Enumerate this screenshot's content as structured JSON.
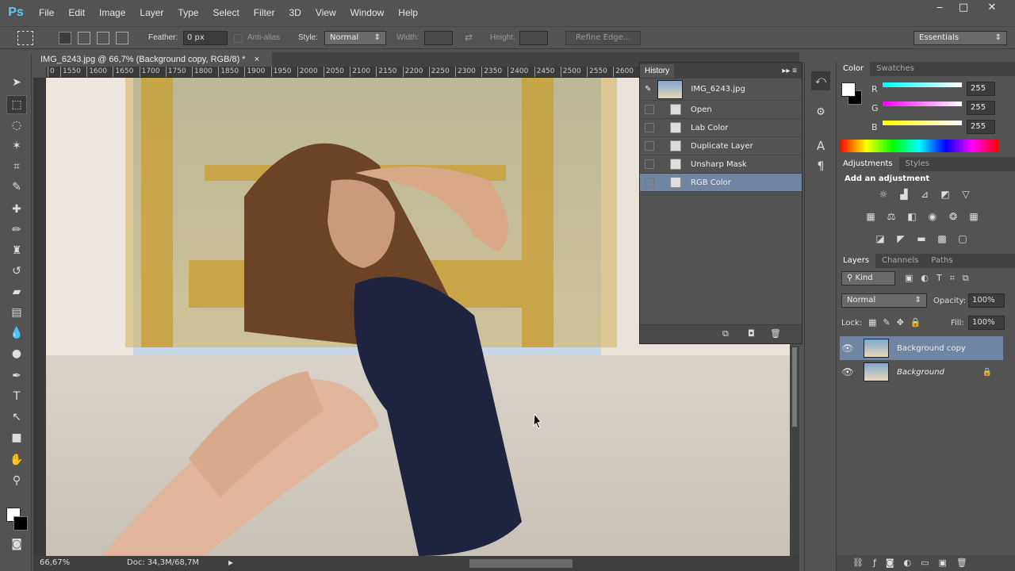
{
  "app": {
    "logo": "Ps"
  },
  "menu": [
    "File",
    "Edit",
    "Image",
    "Layer",
    "Type",
    "Select",
    "Filter",
    "3D",
    "View",
    "Window",
    "Help"
  ],
  "window": {
    "minimize": "‒",
    "maximize": "□",
    "close": "✕"
  },
  "options": {
    "feather_label": "Feather:",
    "feather_value": "0 px",
    "antialias_label": "Anti-alias",
    "style_label": "Style:",
    "style_value": "Normal",
    "width_label": "Width:",
    "height_label": "Height:",
    "refine_edge": "Refine Edge...",
    "workspace": "Essentials"
  },
  "document": {
    "tab_title": "IMG_6243.jpg @ 66,7% (Background copy, RGB/8) *",
    "close": "×"
  },
  "ruler_ticks": [
    "0",
    "1550",
    "1600",
    "1650",
    "1700",
    "1750",
    "1800",
    "1850",
    "1900",
    "1950",
    "2000",
    "2050",
    "2100",
    "2150",
    "2200",
    "2250",
    "2300",
    "2350",
    "2400",
    "2450",
    "2500",
    "2550",
    "2600"
  ],
  "status": {
    "zoom": "66,67%",
    "doc": "Doc: 34,3M/68,7M"
  },
  "history": {
    "title": "History",
    "snapshot": "IMG_6243.jpg",
    "items": [
      "Open",
      "Lab Color",
      "Duplicate Layer",
      "Unsharp Mask",
      "RGB Color"
    ]
  },
  "color": {
    "tabs": [
      "Color",
      "Swatches"
    ],
    "r_label": "R",
    "g_label": "G",
    "b_label": "B",
    "r": "255",
    "g": "255",
    "b": "255"
  },
  "adjustments": {
    "tabs": [
      "Adjustments",
      "Styles"
    ],
    "heading": "Add an adjustment"
  },
  "layers": {
    "tabs": [
      "Layers",
      "Channels",
      "Paths"
    ],
    "filter": "Kind",
    "blend": "Normal",
    "opacity_label": "Opacity:",
    "opacity": "100%",
    "lock_label": "Lock:",
    "fill_label": "Fill:",
    "fill": "100%",
    "items": [
      "Background copy",
      "Background"
    ]
  }
}
